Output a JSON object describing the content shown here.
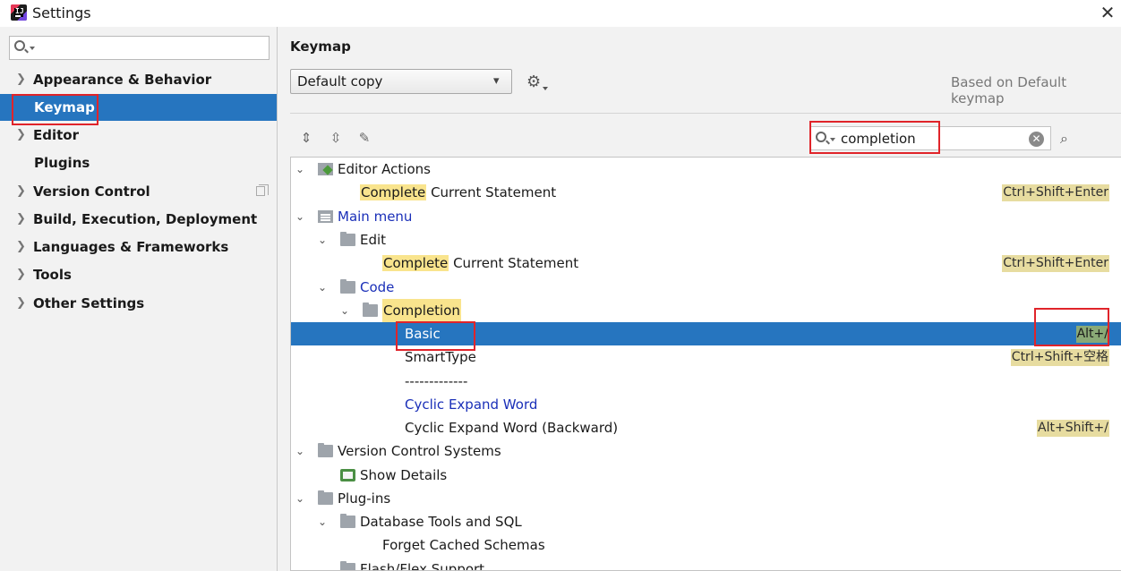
{
  "window": {
    "title": "Settings"
  },
  "sidebar": {
    "search_placeholder": "",
    "items": [
      {
        "label": "Appearance & Behavior"
      },
      {
        "label": "Keymap"
      },
      {
        "label": "Editor"
      },
      {
        "label": "Plugins"
      },
      {
        "label": "Version Control"
      },
      {
        "label": "Build, Execution, Deployment"
      },
      {
        "label": "Languages & Frameworks"
      },
      {
        "label": "Tools"
      },
      {
        "label": "Other Settings"
      }
    ]
  },
  "keymap": {
    "heading": "Keymap",
    "scheme": "Default copy",
    "based_on": "Based on Default keymap",
    "filter_value": "completion"
  },
  "tree": {
    "editor_actions": "Editor Actions",
    "complete_hl": "Complete",
    "complete_rest": " Current Statement",
    "complete_shortcut": "Ctrl+Shift+Enter",
    "main_menu": "Main menu",
    "edit": "Edit",
    "code": "Code",
    "completion": "Completion",
    "basic": "Basic",
    "basic_shortcut": "Alt+/",
    "smarttype": "SmartType",
    "smarttype_shortcut": "Ctrl+Shift+空格",
    "separator": "-------------",
    "cyclic": "Cyclic Expand Word",
    "cyclic_back": "Cyclic Expand Word (Backward)",
    "cyclic_back_shortcut": "Alt+Shift+/",
    "vcs": "Version Control Systems",
    "show_details": "Show Details",
    "plugins": "Plug-ins",
    "db_tools": "Database Tools and SQL",
    "forget_schemas": "Forget Cached Schemas",
    "flash": "Flash/Flex Support"
  },
  "colors": {
    "selection": "#2675bf",
    "highlight": "#f9e48d",
    "annotation": "#e0242a"
  }
}
